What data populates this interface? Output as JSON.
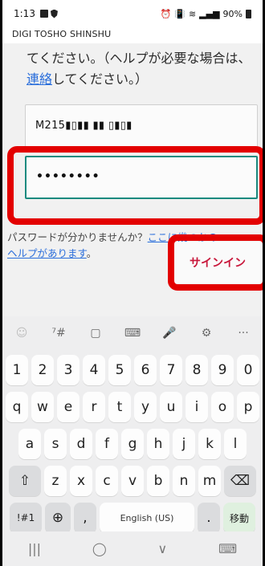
{
  "status_bar": {
    "time": "1:13",
    "battery": "90%",
    "left_icons": [
      "photo-icon",
      "shield-icon"
    ],
    "right_icons": [
      "alarm-icon",
      "vibrate-icon",
      "lte-icon",
      "wifi-icon",
      "signal-icon",
      "battery-icon"
    ]
  },
  "app": {
    "title": "DIGI TOSHO SHINSHU"
  },
  "instructions": {
    "line1": "てください。（ヘルプが必要な場合は、",
    "link": "連絡",
    "line2_rest": "してください。）"
  },
  "form": {
    "username_value": "M215▮▯▮▮ ▮▮ ▯▮▯▮",
    "password_value": "••••••••",
    "help_text": "パスワードが分かりませんか？",
    "help_link_1": "ここに幾つかの",
    "help_link_2": "ヘルプがあります",
    "help_end": "。",
    "signin_label": "サインイン"
  },
  "keyboard": {
    "toolbar": [
      "☺",
      "⁷#",
      "▢",
      "⌨",
      "🎤",
      "⚙",
      "···"
    ],
    "numbers": [
      "1",
      "2",
      "3",
      "4",
      "5",
      "6",
      "7",
      "8",
      "9",
      "0"
    ],
    "row_q": [
      "q",
      "w",
      "e",
      "r",
      "t",
      "y",
      "u",
      "i",
      "o",
      "p"
    ],
    "row_a": [
      "a",
      "s",
      "d",
      "f",
      "g",
      "h",
      "j",
      "k",
      "l"
    ],
    "row_z": [
      "z",
      "x",
      "c",
      "v",
      "b",
      "n",
      "m"
    ],
    "shift": "⇧",
    "backspace": "⌫",
    "sym": "!#1",
    "globe": "⊕",
    "comma": ",",
    "space": "English (US)",
    "period": ".",
    "enter": "移動"
  },
  "nav": {
    "recent": "|||",
    "home": "◯",
    "back": "∨",
    "kbd": "⌨"
  }
}
